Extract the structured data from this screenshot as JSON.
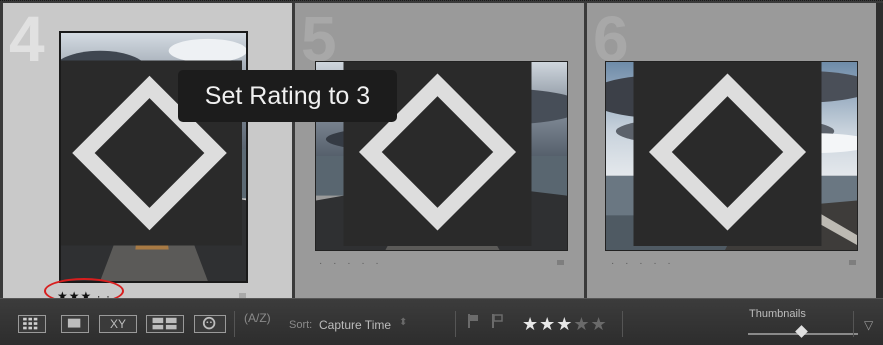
{
  "grid": {
    "cells": [
      {
        "number": "4",
        "stars": "★★★ · ·",
        "selected": true
      },
      {
        "number": "5",
        "stars": "· · · · ·",
        "selected": false
      },
      {
        "number": "6",
        "stars": "· · · · ·",
        "selected": false
      }
    ]
  },
  "tooltip": {
    "text": "Set Rating to 3"
  },
  "toolbar": {
    "grid_view_icon": "grid-icon",
    "loupe_view_icon": "loupe-icon",
    "compare_label": "XY",
    "survey_view_icon": "survey-icon",
    "people_view_icon": "people-icon",
    "sort_icon": "(A/Z)",
    "sort_label": "Sort:",
    "sort_value": "Capture Time",
    "sort_caret": "⬍",
    "flag_pick_icon": "flag-icon",
    "flag_reject_icon": "flag-icon",
    "rating_on": "★★★",
    "rating_off": "★★",
    "rating_value": 3,
    "thumbnails_label": "Thumbnails",
    "thumbnail_size": 0.45,
    "menu_caret": "▽"
  },
  "colors": {
    "selected_cell": "#c9c9c9",
    "cell": "#9a9a9a",
    "highlight_ring": "#d81e1e",
    "tooltip_bg": "#1c1c1c"
  }
}
